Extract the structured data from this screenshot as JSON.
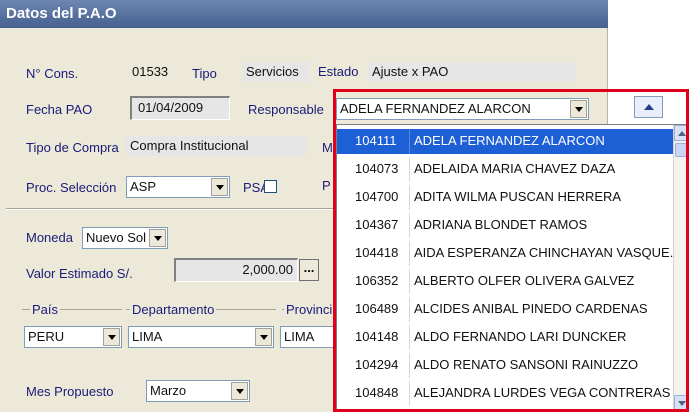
{
  "window": {
    "title": "Datos del P.A.O"
  },
  "form": {
    "num_cons_label": "N° Cons.",
    "num_cons_value": "01533",
    "tipo_label": "Tipo",
    "tipo_value": "Servicios",
    "estado_label": "Estado",
    "estado_value": "Ajuste x PAO",
    "fecha_label": "Fecha PAO",
    "fecha_value": "01/04/2009",
    "responsable_label": "Responsable",
    "responsable_value": "ADELA FERNANDEZ ALARCON",
    "tipo_compra_label": "Tipo de Compra",
    "tipo_compra_value": "Compra Institucional",
    "hidden_m_label": "M",
    "proc_label": "Proc. Selección",
    "proc_value": "ASP",
    "psa_label": "PSA",
    "hidden_p_label": "P",
    "moneda_label": "Moneda",
    "moneda_value": "Nuevo Sol",
    "valor_label": "Valor Estimado S/.",
    "valor_value": "2,000.00",
    "ellipsis_label": "...",
    "pais_label": "País",
    "pais_value": "PERU",
    "departamento_label": "Departamento",
    "departamento_value": "LIMA",
    "provincia_label": "Provinci",
    "provincia_value": "LIMA",
    "mes_label": "Mes Propuesto",
    "mes_value": "Marzo"
  },
  "dropdown_list": [
    {
      "code": "104111",
      "name": "ADELA FERNANDEZ ALARCON",
      "selected": true
    },
    {
      "code": "104073",
      "name": "ADELAIDA MARIA CHAVEZ DAZA"
    },
    {
      "code": "104700",
      "name": "ADITA WILMA PUSCAN HERRERA"
    },
    {
      "code": "104367",
      "name": "ADRIANA BLONDET RAMOS"
    },
    {
      "code": "104418",
      "name": "AIDA ESPERANZA CHINCHAYAN VASQUE."
    },
    {
      "code": "106352",
      "name": "ALBERTO OLFER OLIVERA GALVEZ"
    },
    {
      "code": "106489",
      "name": "ALCIDES ANIBAL PINEDO CARDENAS"
    },
    {
      "code": "104148",
      "name": "ALDO FERNANDO LARI DUNCKER"
    },
    {
      "code": "104294",
      "name": "ALDO RENATO SANSONI RAINUZZO"
    },
    {
      "code": "104848",
      "name": "ALEJANDRA LURDES VEGA CONTRERAS"
    }
  ],
  "colors": {
    "highlight": "#e0001b",
    "selection": "#1d5fd5",
    "title_bar": "#4f6998"
  }
}
